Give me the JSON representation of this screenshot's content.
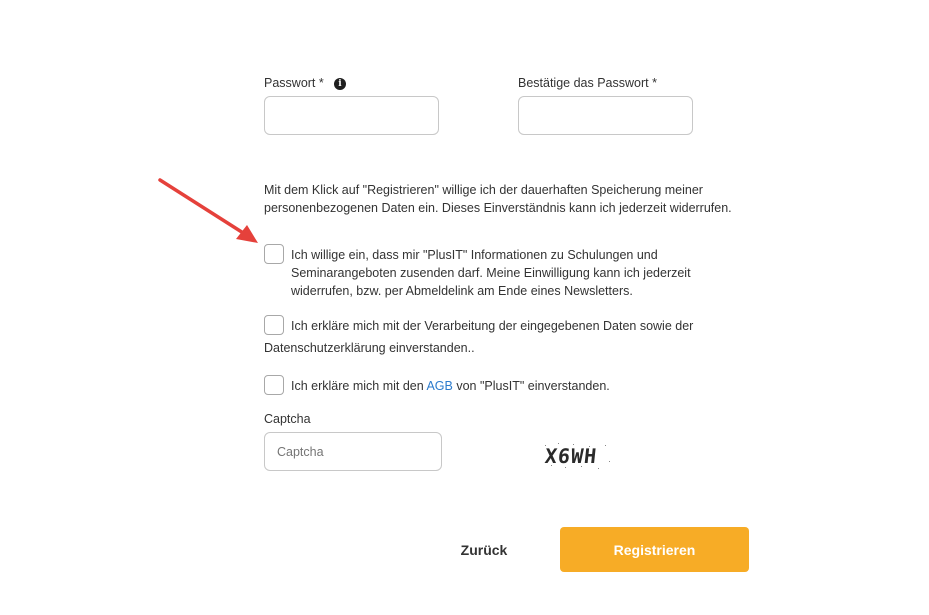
{
  "password": {
    "label": "Passwort *",
    "value": ""
  },
  "confirm_password": {
    "label": "Bestätige das Passwort *",
    "value": ""
  },
  "consent_notice": "Mit dem Klick auf \"Registrieren\" willige ich der dauerhaften Speicherung meiner personenbezogenen Daten ein. Dieses Einverständnis kann ich jederzeit widerrufen.",
  "checkboxes": {
    "newsletter": {
      "label": "Ich willige ein, dass mir \"PlusIT\" Informationen zu Schulungen und Seminarangeboten zusenden darf. Meine Einwilligung kann ich jederzeit widerrufen, bzw. per Abmeldelink am Ende eines Newsletters.",
      "checked": false
    },
    "privacy": {
      "label_line1": "Ich erkläre mich mit der Verarbeitung der eingegebenen Daten sowie der",
      "label_line2": "Datenschutzerklärung einverstanden..",
      "checked": false
    },
    "terms": {
      "label_before": "Ich erkläre mich mit den ",
      "link_text": "AGB",
      "label_after": " von \"PlusIT\" einverstanden.",
      "checked": false
    }
  },
  "captcha": {
    "label": "Captcha",
    "placeholder": "Captcha",
    "image_text": "X6WH"
  },
  "buttons": {
    "back": "Zurück",
    "register": "Registrieren"
  },
  "colors": {
    "primary": "#f7ac26",
    "link": "#2c7bcc",
    "annotation_arrow": "#e5413b"
  },
  "icons": {
    "info": "info-icon",
    "arrow": "annotation-arrow-icon"
  }
}
